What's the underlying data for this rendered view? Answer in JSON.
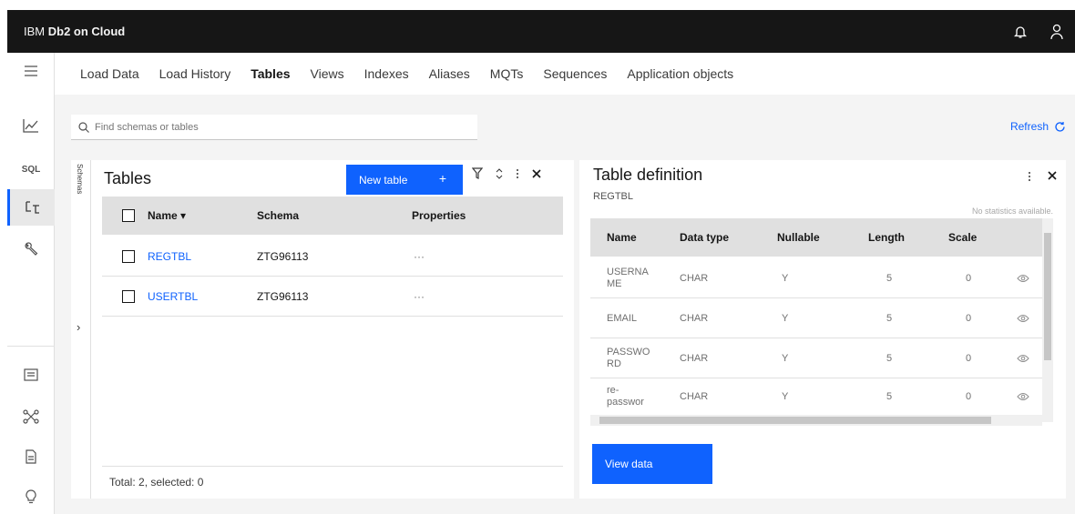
{
  "app": {
    "brand_prefix": "IBM ",
    "brand_name": "Db2 on Cloud"
  },
  "tabs": [
    {
      "label": "Load Data",
      "active": false
    },
    {
      "label": "Load History",
      "active": false
    },
    {
      "label": "Tables",
      "active": true
    },
    {
      "label": "Views",
      "active": false
    },
    {
      "label": "Indexes",
      "active": false
    },
    {
      "label": "Aliases",
      "active": false
    },
    {
      "label": "MQTs",
      "active": false
    },
    {
      "label": "Sequences",
      "active": false
    },
    {
      "label": "Application objects",
      "active": false
    }
  ],
  "rail": {
    "sql_label": "SQL"
  },
  "search": {
    "placeholder": "Find schemas or tables"
  },
  "refresh_label": "Refresh",
  "schemas_label": "Schemas",
  "tables_panel": {
    "title": "Tables",
    "new_table_label": "New table",
    "new_table_icon": "+",
    "columns": {
      "name": "Name",
      "schema": "Schema",
      "properties": "Properties"
    },
    "rows": [
      {
        "name": "REGTBL",
        "schema": "ZTG96113",
        "properties": "···"
      },
      {
        "name": "USERTBL",
        "schema": "ZTG96113",
        "properties": "···"
      }
    ],
    "footer": "Total: 2, selected: 0"
  },
  "definition": {
    "title": "Table definition",
    "table_name": "REGTBL",
    "no_stats": "No statistics available.",
    "columns": {
      "name": "Name",
      "data_type": "Data type",
      "nullable": "Nullable",
      "length": "Length",
      "scale": "Scale"
    },
    "rows": [
      {
        "name": "USERNA\nME",
        "data_type": "CHAR",
        "nullable": "Y",
        "length": "5",
        "scale": "0"
      },
      {
        "name": "EMAIL",
        "data_type": "CHAR",
        "nullable": "Y",
        "length": "5",
        "scale": "0"
      },
      {
        "name": "PASSWO\nRD",
        "data_type": "CHAR",
        "nullable": "Y",
        "length": "5",
        "scale": "0"
      },
      {
        "name": "re-\npasswor",
        "data_type": "CHAR",
        "nullable": "Y",
        "length": "5",
        "scale": "0"
      }
    ],
    "view_data_label": "View data"
  },
  "colors": {
    "accent": "#0f62fe",
    "header_bg": "#161616",
    "table_header_bg": "#e0e0e0"
  }
}
